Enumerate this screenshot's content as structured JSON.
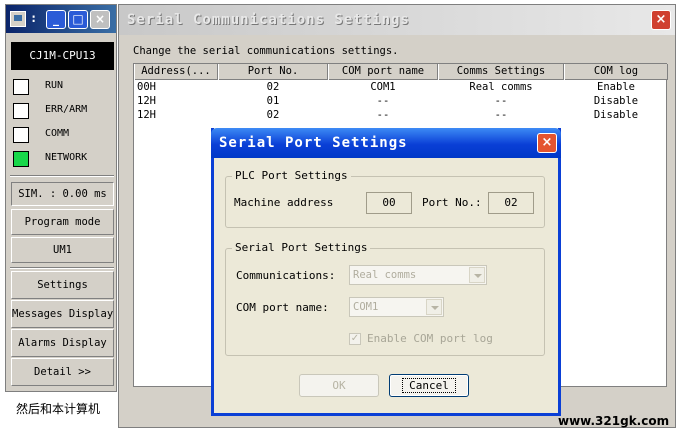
{
  "simulator": {
    "colon": ":",
    "window_buttons": {
      "minimize": "_",
      "maximize": "□",
      "close": "×"
    },
    "cpu_model": "CJ1M-CPU13",
    "leds": [
      {
        "label": "RUN",
        "on": false
      },
      {
        "label": "ERR/ARM",
        "on": false
      },
      {
        "label": "COMM",
        "on": false
      },
      {
        "label": "NETWORK",
        "on": true,
        "color": "#18d84a"
      }
    ],
    "cycle_time": "SIM. : 0.00 ms",
    "mode": "Program mode",
    "um": "UM1",
    "buttons": {
      "settings": "Settings",
      "messages": "Messages Display",
      "alarms": "Alarms Display",
      "detail": "Detail >>"
    }
  },
  "serial_comm": {
    "title": "Serial Communications Settings",
    "close_glyph": "×",
    "description": "Change the serial communications settings.",
    "columns": [
      "Address(...",
      "Port No.",
      "COM port name",
      "Comms Settings",
      "COM log"
    ],
    "rows": [
      [
        "00H",
        "02",
        "COM1",
        "Real comms",
        "Enable"
      ],
      [
        "12H",
        "01",
        "--",
        "--",
        "Disable"
      ],
      [
        "12H",
        "02",
        "--",
        "--",
        "Disable"
      ]
    ]
  },
  "serial_port_dialog": {
    "title": "Serial Port Settings",
    "close_glyph": "×",
    "plc_group": {
      "legend": "PLC Port Settings",
      "machine_address_label": "Machine address",
      "machine_address_value": "00",
      "port_no_label": "Port No.:",
      "port_no_value": "02"
    },
    "serial_group": {
      "legend": "Serial Port Settings",
      "communications_label": "Communications:",
      "communications_value": "Real comms",
      "com_port_label": "COM port name:",
      "com_port_value": "COM1",
      "enable_log_label": "Enable COM port log",
      "enable_log_checked": true,
      "check_glyph": "✓"
    },
    "ok_label": "OK",
    "cancel_label": "Cancel"
  },
  "background_text": "然后和本计算机",
  "watermark": "www.321gk.com"
}
